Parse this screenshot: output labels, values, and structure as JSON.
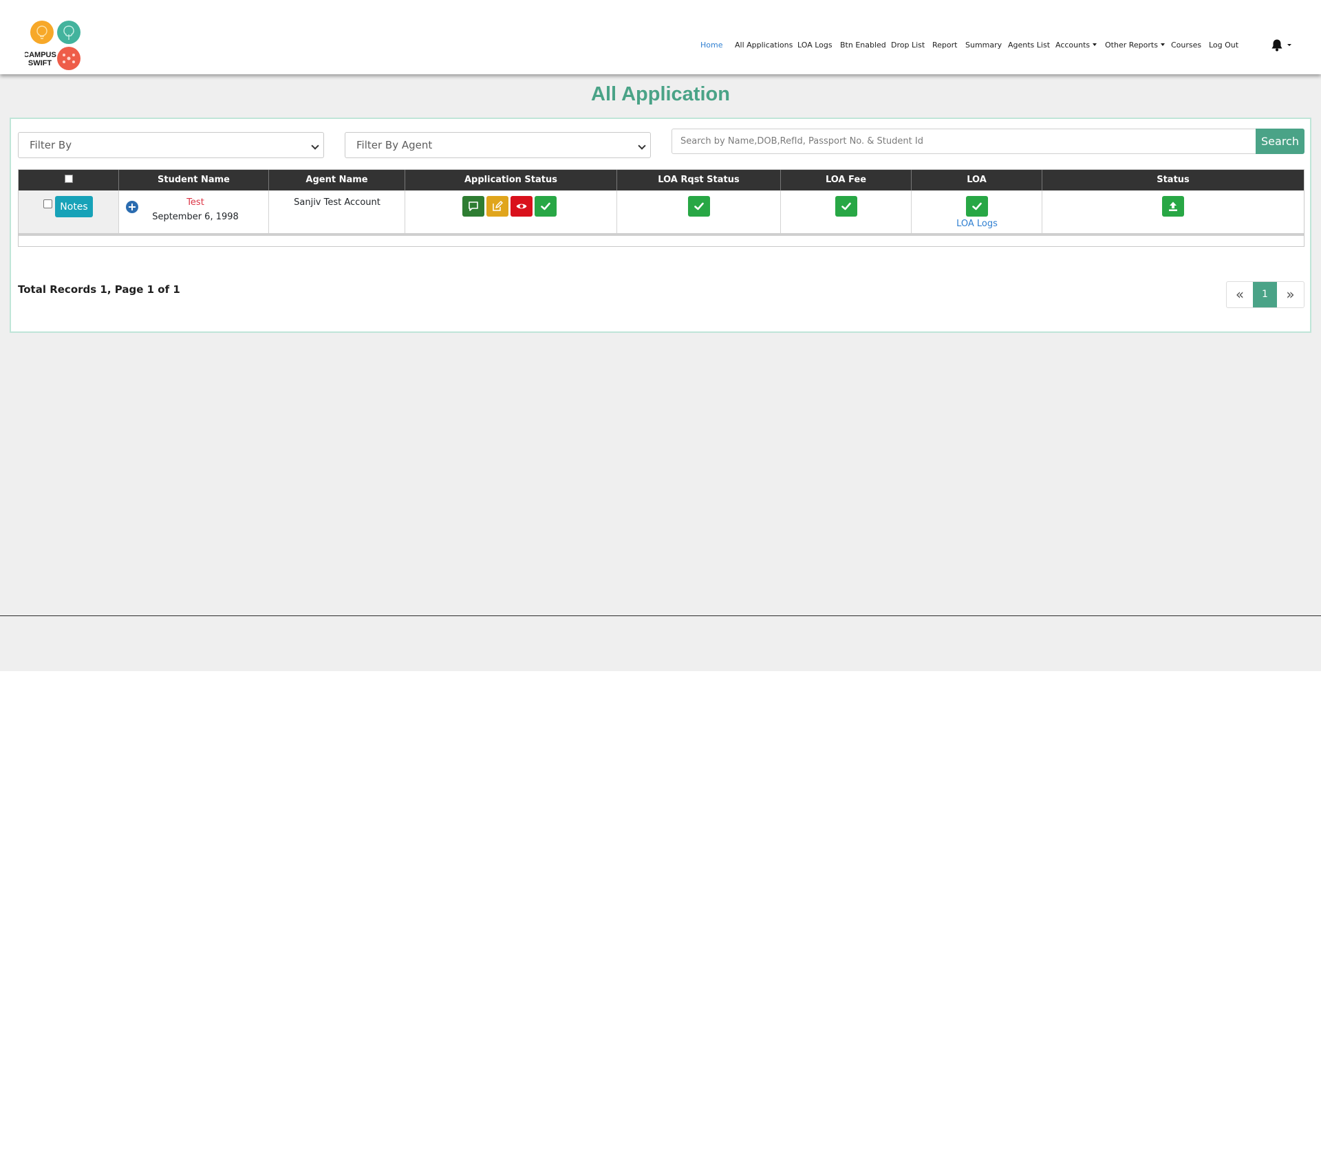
{
  "brand": {
    "logo_text_line1": "CAMPUS",
    "logo_text_line2": "SWIFT",
    "colors": {
      "orange": "#f7a829",
      "teal": "#43b39d",
      "coral": "#ee5d49"
    }
  },
  "nav": {
    "items": [
      {
        "label": "Home",
        "active": true
      },
      {
        "label": "All Applications"
      },
      {
        "label": "LOA Logs"
      },
      {
        "label": "Btn Enabled"
      },
      {
        "label": "Drop List"
      },
      {
        "label": "Report"
      },
      {
        "label": "Summary"
      },
      {
        "label": "Agents List"
      },
      {
        "label": "Accounts",
        "dropdown": true
      },
      {
        "label": "Other Reports",
        "dropdown": true
      },
      {
        "label": "Courses"
      },
      {
        "label": "Log Out"
      }
    ],
    "notification_icon": "bell-icon"
  },
  "page": {
    "title": "All Application",
    "accent_color": "#4aa387"
  },
  "filters": {
    "filter_by": "Filter By",
    "filter_by_agent": "Filter By Agent",
    "search_placeholder": "Search by Name,DOB,RefId, Passport No. & Student Id",
    "search_button": "Search"
  },
  "table": {
    "columns": [
      "",
      "Student Name",
      "Agent Name",
      "Application Status",
      "LOA Rqst Status",
      "LOA Fee",
      "LOA",
      "Status"
    ],
    "rows": [
      {
        "notes_label": "Notes",
        "student_name": "Test",
        "dob": "September 6, 1998",
        "agent_name": "Sanjiv Test Account",
        "application_status_icons": [
          "comment-icon",
          "edit-icon",
          "eye-icon",
          "check-icon"
        ],
        "loa_rqst_status_icon": "check-icon",
        "loa_fee_icon": "check-icon",
        "loa_icon": "check-icon",
        "loa_logs_link": "LOA Logs",
        "status_icon": "upload-icon"
      }
    ]
  },
  "footer": {
    "total_records": "Total Records 1, Page 1 of 1",
    "pagination": {
      "prev": "«",
      "current": "1",
      "next": "»"
    }
  }
}
